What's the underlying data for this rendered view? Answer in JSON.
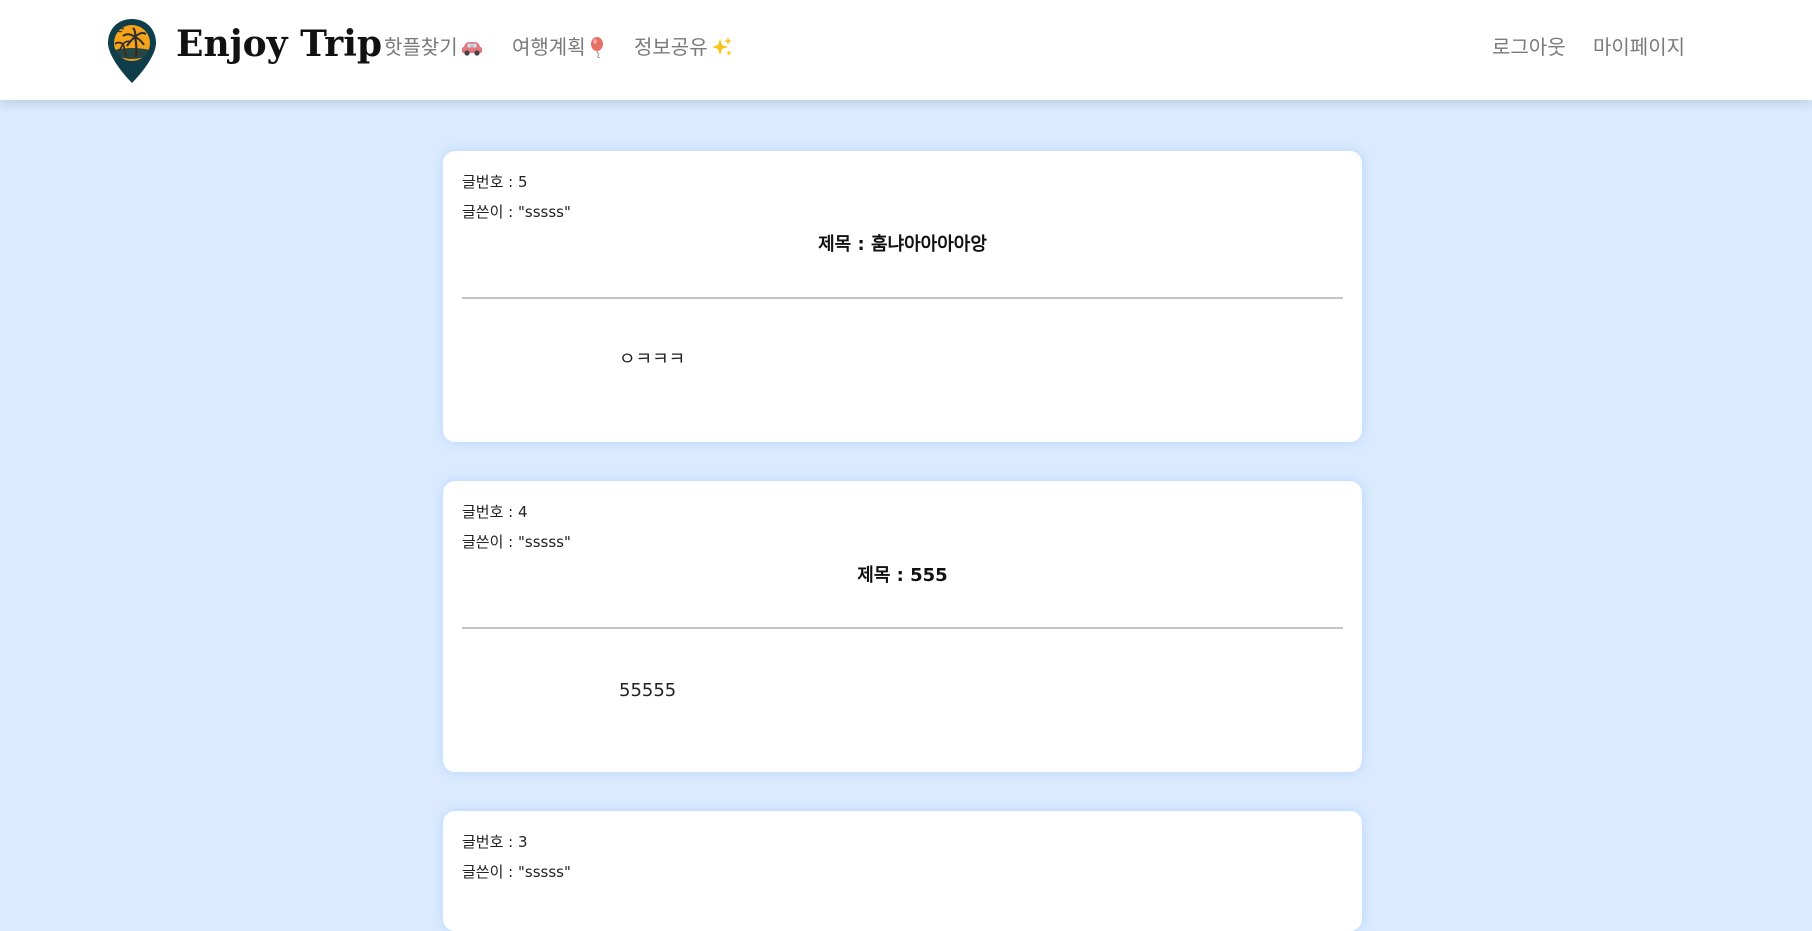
{
  "header": {
    "brand": "Enjoy Trip",
    "nav": [
      {
        "label": "핫플찾기",
        "icon": "car-icon"
      },
      {
        "label": "여행계획",
        "icon": "balloon-icon"
      },
      {
        "label": "정보공유",
        "icon": "sparkles-icon"
      }
    ],
    "right_nav": [
      {
        "label": "로그아웃"
      },
      {
        "label": "마이페이지"
      }
    ]
  },
  "posts": [
    {
      "number_label": "글번호 : 5",
      "author_label": "글쓴이 : \"sssss\"",
      "title": "제목 : 훔냐아아아아앙",
      "content": "ㅇㅋㅋㅋ"
    },
    {
      "number_label": "글번호 : 4",
      "author_label": "글쓴이 : \"sssss\"",
      "title": "제목 : 555",
      "content": "55555"
    },
    {
      "number_label": "글번호 : 3",
      "author_label": "글쓴이 : \"sssss\"",
      "title": "",
      "content": ""
    }
  ],
  "colors": {
    "page_background": "#dbeafe",
    "card_background": "#ffffff",
    "nav_text": "#7a7a7a",
    "logo_dark": "#0f3d4a",
    "logo_sun": "#f5a31a"
  }
}
